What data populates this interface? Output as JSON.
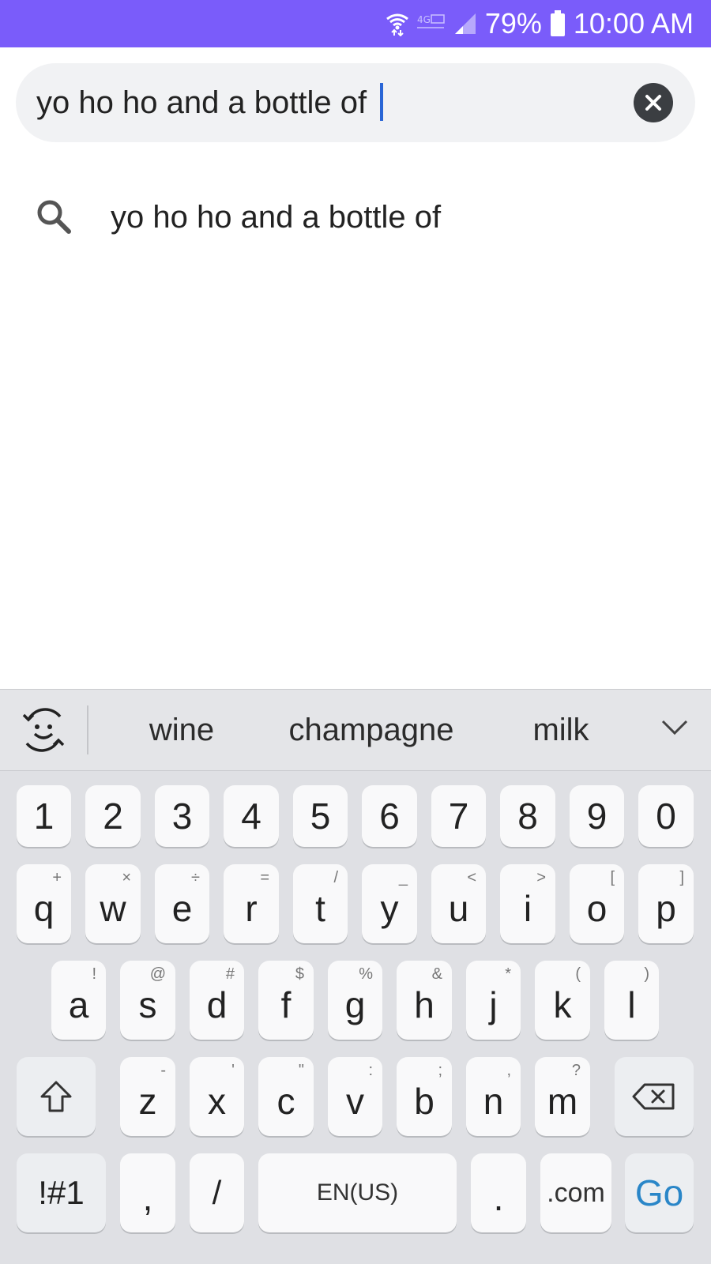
{
  "status_bar": {
    "battery_percent": "79%",
    "time": "10:00 AM",
    "icons": [
      "wifi-icon",
      "4g-lte-icon",
      "signal-icon",
      "battery-icon"
    ],
    "background": "#7a5cfa"
  },
  "search": {
    "query": "yo ho ho and a bottle of ",
    "clear_icon": "close-icon"
  },
  "suggestions": [
    {
      "icon": "search-icon",
      "text": "yo ho ho and a bottle of"
    }
  ],
  "keyboard": {
    "predictions": [
      "wine",
      "champagne",
      "milk"
    ],
    "number_row": [
      "1",
      "2",
      "3",
      "4",
      "5",
      "6",
      "7",
      "8",
      "9",
      "0"
    ],
    "row1": [
      {
        "key": "q",
        "alt": "+"
      },
      {
        "key": "w",
        "alt": "×"
      },
      {
        "key": "e",
        "alt": "÷"
      },
      {
        "key": "r",
        "alt": "="
      },
      {
        "key": "t",
        "alt": "/"
      },
      {
        "key": "y",
        "alt": "_"
      },
      {
        "key": "u",
        "alt": "<"
      },
      {
        "key": "i",
        "alt": ">"
      },
      {
        "key": "o",
        "alt": "["
      },
      {
        "key": "p",
        "alt": "]"
      }
    ],
    "row2": [
      {
        "key": "a",
        "alt": "!"
      },
      {
        "key": "s",
        "alt": "@"
      },
      {
        "key": "d",
        "alt": "#"
      },
      {
        "key": "f",
        "alt": "$"
      },
      {
        "key": "g",
        "alt": "%"
      },
      {
        "key": "h",
        "alt": "&"
      },
      {
        "key": "j",
        "alt": "*"
      },
      {
        "key": "k",
        "alt": "("
      },
      {
        "key": "l",
        "alt": ")"
      }
    ],
    "row3": [
      {
        "key": "z",
        "alt": "-"
      },
      {
        "key": "x",
        "alt": "'"
      },
      {
        "key": "c",
        "alt": "\""
      },
      {
        "key": "v",
        "alt": ":"
      },
      {
        "key": "b",
        "alt": ";"
      },
      {
        "key": "n",
        "alt": ","
      },
      {
        "key": "m",
        "alt": "?"
      }
    ],
    "bottom": {
      "symbols": "!#1",
      "comma": ",",
      "slash": "/",
      "space": "EN(US)",
      "period": ".",
      "dotcom": ".com",
      "go": "Go"
    },
    "accent_color": "#2a86c8"
  }
}
